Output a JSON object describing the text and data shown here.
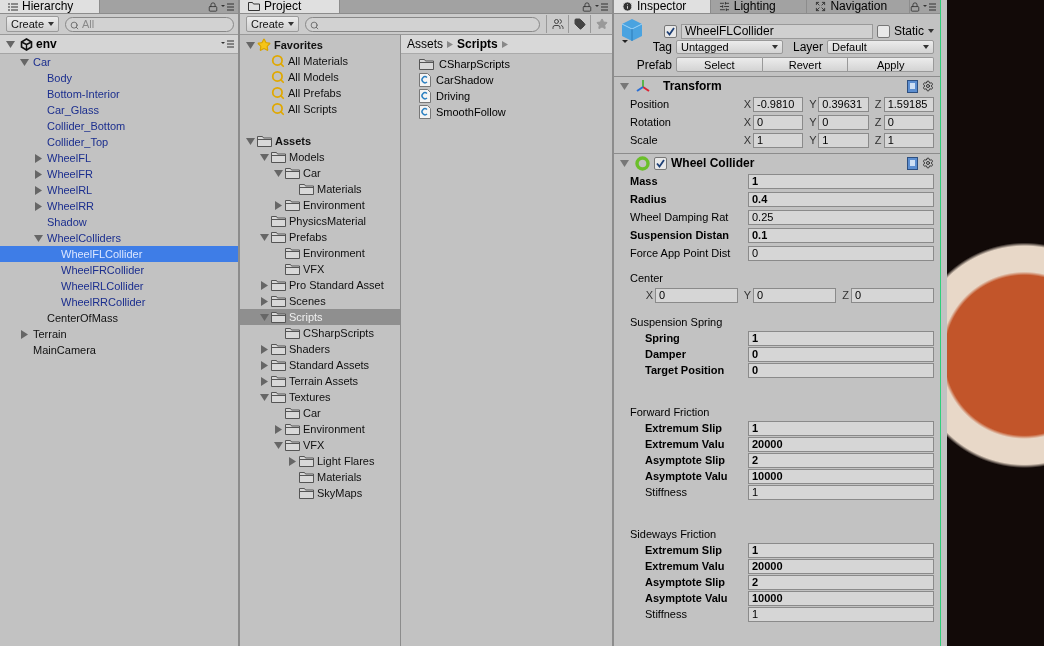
{
  "hierarchy": {
    "title": "Hierarchy",
    "create": "Create",
    "search": {
      "placeholder": "All"
    },
    "scene": {
      "name": "env",
      "expanded": true,
      "children": [
        {
          "label": "Car",
          "kind": "prefab",
          "expanded": true,
          "selected": false,
          "children": [
            {
              "label": "Body",
              "kind": "prefab",
              "selected": false
            },
            {
              "label": "Bottom-Interior",
              "kind": "prefab",
              "selected": false
            },
            {
              "label": "Car_Glass",
              "kind": "prefab",
              "selected": false
            },
            {
              "label": "Collider_Bottom",
              "kind": "prefab",
              "selected": false
            },
            {
              "label": "Collider_Top",
              "kind": "prefab",
              "selected": false
            },
            {
              "label": "WheelFL",
              "kind": "prefab",
              "expanded": false,
              "selected": false
            },
            {
              "label": "WheelFR",
              "kind": "prefab",
              "expanded": false,
              "selected": false
            },
            {
              "label": "WheelRL",
              "kind": "prefab",
              "expanded": false,
              "selected": false
            },
            {
              "label": "WheelRR",
              "kind": "prefab",
              "expanded": false,
              "selected": false
            },
            {
              "label": "Shadow",
              "kind": "prefab",
              "selected": false
            },
            {
              "label": "WheelColliders",
              "kind": "prefab",
              "expanded": true,
              "selected": false,
              "children": [
                {
                  "label": "WheelFLCollider",
                  "kind": "prefab",
                  "selected": true
                },
                {
                  "label": "WheelFRCollider",
                  "kind": "prefab",
                  "selected": false
                },
                {
                  "label": "WheelRLCollider",
                  "kind": "prefab",
                  "selected": false
                },
                {
                  "label": "WheelRRCollider",
                  "kind": "prefab",
                  "selected": false
                }
              ]
            },
            {
              "label": "CenterOfMass",
              "kind": "object",
              "selected": false
            }
          ]
        },
        {
          "label": "Terrain",
          "kind": "object",
          "expanded": false,
          "selected": false
        },
        {
          "label": "MainCamera",
          "kind": "object",
          "selected": false
        }
      ]
    }
  },
  "project": {
    "title": "Project",
    "create": "Create",
    "favorites": {
      "label": "Favorites",
      "expanded": true,
      "items": [
        {
          "label": "All Materials",
          "selected": false
        },
        {
          "label": "All Models",
          "selected": false
        },
        {
          "label": "All Prefabs",
          "selected": false
        },
        {
          "label": "All Scripts",
          "selected": false
        }
      ]
    },
    "assets": {
      "label": "Assets",
      "expanded": true,
      "selected": false,
      "children": [
        {
          "label": "Models",
          "expanded": true,
          "selected": false,
          "children": [
            {
              "label": "Car",
              "expanded": true,
              "selected": false,
              "children": [
                {
                  "label": "Materials",
                  "selected": false
                }
              ]
            },
            {
              "label": "Environment",
              "expanded": false,
              "selected": false
            }
          ]
        },
        {
          "label": "PhysicsMaterial",
          "selected": false
        },
        {
          "label": "Prefabs",
          "expanded": true,
          "selected": false,
          "children": [
            {
              "label": "Environment",
              "selected": false
            },
            {
              "label": "VFX",
              "selected": false
            }
          ]
        },
        {
          "label": "Pro Standard Asset",
          "expanded": false,
          "selected": false
        },
        {
          "label": "Scenes",
          "expanded": false,
          "selected": false
        },
        {
          "label": "Scripts",
          "expanded": true,
          "selected": true,
          "children": [
            {
              "label": "CSharpScripts",
              "selected": false
            }
          ]
        },
        {
          "label": "Shaders",
          "expanded": false,
          "selected": false
        },
        {
          "label": "Standard Assets",
          "expanded": false,
          "selected": false
        },
        {
          "label": "Terrain Assets",
          "expanded": false,
          "selected": false
        },
        {
          "label": "Textures",
          "expanded": true,
          "selected": false,
          "children": [
            {
              "label": "Car",
              "selected": false
            },
            {
              "label": "Environment",
              "expanded": false,
              "selected": false
            },
            {
              "label": "VFX",
              "expanded": true,
              "selected": false,
              "children": [
                {
                  "label": "Light Flares",
                  "expanded": false,
                  "selected": false
                },
                {
                  "label": "Materials",
                  "selected": false
                },
                {
                  "label": "SkyMaps",
                  "selected": false
                }
              ]
            }
          ]
        }
      ]
    },
    "breadcrumb": [
      "Assets",
      "Scripts"
    ],
    "files": [
      {
        "name": "CSharpScripts",
        "kind": "folder"
      },
      {
        "name": "CarShadow",
        "kind": "script"
      },
      {
        "name": "Driving",
        "kind": "script"
      },
      {
        "name": "SmoothFollow",
        "kind": "script"
      }
    ]
  },
  "inspector": {
    "tabs": [
      {
        "label": "Inspector",
        "kind": "info",
        "selected": true
      },
      {
        "label": "Lighting",
        "kind": "lighting",
        "selected": false
      },
      {
        "label": "Navigation",
        "kind": "navigation",
        "selected": false
      }
    ],
    "object": {
      "active": true,
      "name": "WheelFLCollider",
      "static": false,
      "static_label": "Static",
      "tag_label": "Tag",
      "tag": "Untagged",
      "layer_label": "Layer",
      "layer": "Default",
      "prefab_label": "Prefab",
      "prefab_buttons": [
        "Select",
        "Revert",
        "Apply"
      ]
    },
    "components": [
      {
        "kind": "transform",
        "title": "Transform",
        "expanded": true,
        "rows": [
          {
            "label": "Position",
            "values": [
              {
                "axis": "X",
                "value": "-0.9810"
              },
              {
                "axis": "Y",
                "value": "0.39631"
              },
              {
                "axis": "Z",
                "value": "1.59185"
              }
            ]
          },
          {
            "label": "Rotation",
            "values": [
              {
                "axis": "X",
                "value": "0"
              },
              {
                "axis": "Y",
                "value": "0"
              },
              {
                "axis": "Z",
                "value": "0"
              }
            ]
          },
          {
            "label": "Scale",
            "values": [
              {
                "axis": "X",
                "value": "1"
              },
              {
                "axis": "Y",
                "value": "1"
              },
              {
                "axis": "Z",
                "value": "1"
              }
            ]
          }
        ]
      },
      {
        "kind": "wheel_collider",
        "title": "Wheel Collider",
        "expanded": true,
        "enabled": true,
        "fields": [
          {
            "label": "Mass",
            "value": "1",
            "overridden": true
          },
          {
            "label": "Radius",
            "value": "0.4",
            "overridden": true
          },
          {
            "label": "Wheel Damping Rat",
            "value": "0.25",
            "overridden": false
          },
          {
            "label": "Suspension Distan",
            "value": "0.1",
            "overridden": true
          },
          {
            "label": "Force App Point Dist",
            "value": "0",
            "overridden": false
          }
        ],
        "center": {
          "label": "Center",
          "values": [
            {
              "axis": "X",
              "value": "0"
            },
            {
              "axis": "Y",
              "value": "0"
            },
            {
              "axis": "Z",
              "value": "0"
            }
          ]
        },
        "groups": [
          {
            "title": "Suspension Spring",
            "fields": [
              {
                "label": "Spring",
                "value": "1",
                "overridden": true
              },
              {
                "label": "Damper",
                "value": "0",
                "overridden": true
              },
              {
                "label": "Target Position",
                "value": "0",
                "overridden": true
              }
            ]
          },
          {
            "title": "Forward Friction",
            "fields": [
              {
                "label": "Extremum Slip",
                "value": "1",
                "overridden": true
              },
              {
                "label": "Extremum Valu",
                "value": "20000",
                "overridden": true
              },
              {
                "label": "Asymptote Slip",
                "value": "2",
                "overridden": true
              },
              {
                "label": "Asymptote Valu",
                "value": "10000",
                "overridden": true
              },
              {
                "label": "Stiffness",
                "value": "1",
                "overridden": false
              }
            ]
          },
          {
            "title": "Sideways Friction",
            "fields": [
              {
                "label": "Extremum Slip",
                "value": "1",
                "overridden": true
              },
              {
                "label": "Extremum Valu",
                "value": "20000",
                "overridden": true
              },
              {
                "label": "Asymptote Slip",
                "value": "2",
                "overridden": true
              },
              {
                "label": "Asymptote Valu",
                "value": "10000",
                "overridden": true
              },
              {
                "label": "Stiffness",
                "value": "1",
                "overridden": false
              }
            ]
          }
        ]
      }
    ]
  }
}
